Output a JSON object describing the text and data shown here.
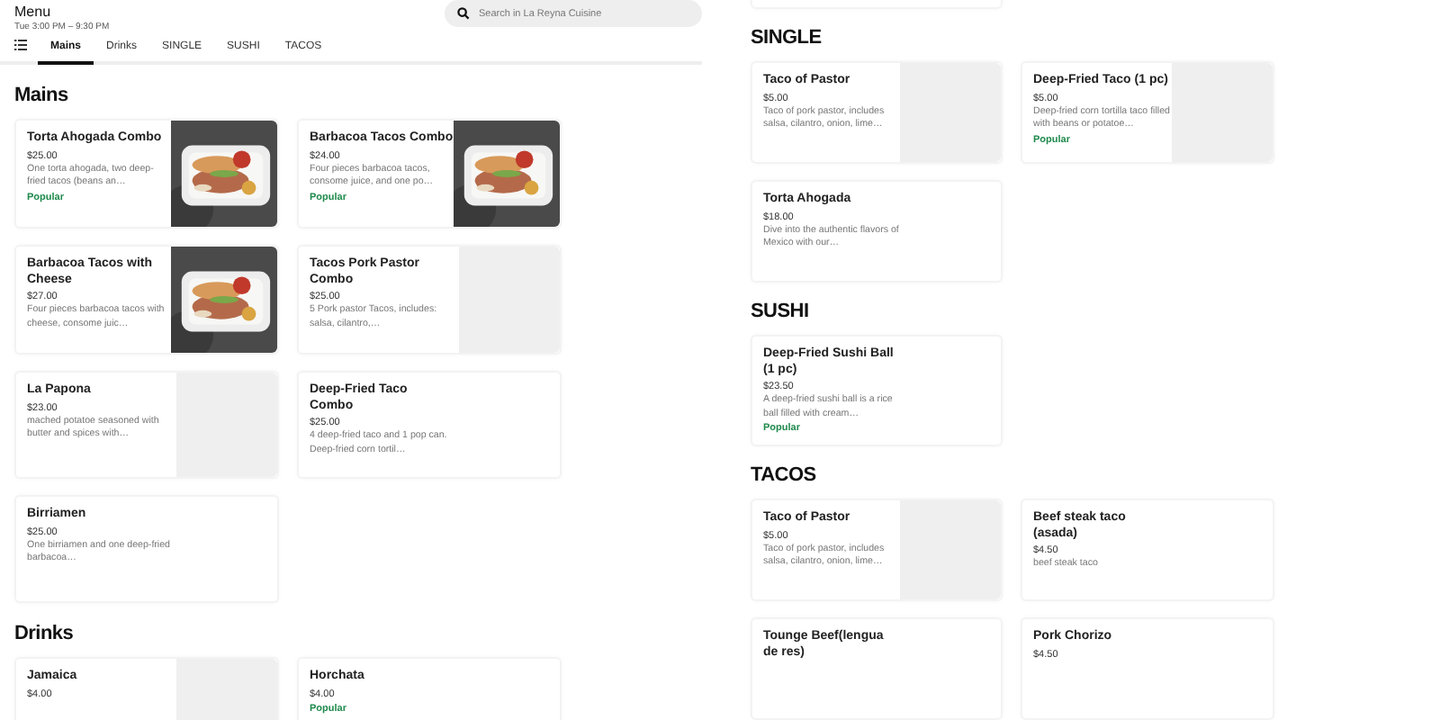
{
  "header": {
    "title": "Menu",
    "hours": "Tue 3:00 PM – 9:30 PM",
    "search": {
      "placeholder": "Search in La Reyna Cuisine"
    }
  },
  "tabs": [
    {
      "label": "Mains",
      "selected": true
    },
    {
      "label": "Drinks",
      "selected": false
    },
    {
      "label": "SINGLE",
      "selected": false
    },
    {
      "label": "SUSHI",
      "selected": false
    },
    {
      "label": "TACOS",
      "selected": false
    }
  ],
  "columns": [
    {
      "sections": [
        {
          "title": "Mains",
          "items": [
            {
              "name": "Torta Ahogada Combo",
              "price": "$25.00",
              "description": "One torta ahogada, two deep-fried tacos (beans an…",
              "badge": "Popular"
            },
            {
              "name": "Barbacoa Tacos Combo",
              "price": "$24.00",
              "description": "Four pieces barbacoa tacos, consome juice, and one po…",
              "badge": "Popular"
            },
            {
              "name": "Barbacoa Tacos with Cheese",
              "price": "$27.00",
              "description": "Four pieces barbacoa tacos with cheese, consome juic…"
            },
            {
              "kind": "placeholder",
              "name": "Tacos Pork Pastor Combo",
              "price": "$25.00",
              "description": "5 Pork pastor Tacos, includes: salsa, cilantro,…"
            },
            {
              "kind": "placeholder",
              "name": "La Papona",
              "price": "$23.00",
              "description": "mached potatoe seasoned with butter and spices with…"
            },
            {
              "kind": "text",
              "name": "Deep-Fried Taco Combo",
              "price": "$25.00",
              "description": "4 deep-fried taco and 1 pop can. Deep-fried corn tortil…"
            },
            {
              "kind": "text",
              "name": "Birriamen",
              "price": "$25.00",
              "description": "One birriamen and one deep-fried barbacoa…"
            }
          ]
        },
        {
          "title": "Drinks",
          "items": [
            {
              "kind": "placeholder",
              "name": "Jamaica",
              "price": "$4.00"
            },
            {
              "kind": "text",
              "name": "Horchata",
              "price": "$4.00",
              "badge": "Popular"
            }
          ]
        }
      ]
    },
    {
      "sections": [
        {
          "title": "SINGLE",
          "items": [
            {
              "kind": "placeholder",
              "name": "Taco of Pastor",
              "price": "$5.00",
              "description": "Taco of pork pastor, includes salsa, cilantro, onion, lime…"
            },
            {
              "kind": "placeholder",
              "name": "Deep-Fried Taco (1 pc)",
              "price": "$5.00",
              "description": "Deep-fried corn tortilla taco filled with beans or potatoe…",
              "badge": "Popular"
            },
            {
              "kind": "text",
              "name": "Torta Ahogada",
              "price": "$18.00",
              "description": "Dive into the authentic flavors of Mexico with our…"
            }
          ]
        },
        {
          "title": "SUSHI",
          "items": [
            {
              "kind": "text",
              "name": "Deep-Fried Sushi Ball (1 pc)",
              "price": "$23.50",
              "description": "A deep-fried sushi ball is a rice ball filled with cream…",
              "badge": "Popular"
            }
          ]
        },
        {
          "title": "TACOS",
          "items": [
            {
              "kind": "placeholder",
              "name": "Taco of Pastor",
              "price": "$5.00",
              "description": "Taco of pork pastor, includes salsa, cilantro, onion, lime…"
            },
            {
              "kind": "text",
              "name": "Beef steak taco (asada)",
              "price": "$4.50",
              "description": "beef steak taco"
            },
            {
              "kind": "text",
              "name": "Tounge Beef(lengua de res)"
            },
            {
              "kind": "text",
              "name": "Pork Chorizo",
              "price": "$4.50"
            }
          ]
        }
      ]
    }
  ]
}
